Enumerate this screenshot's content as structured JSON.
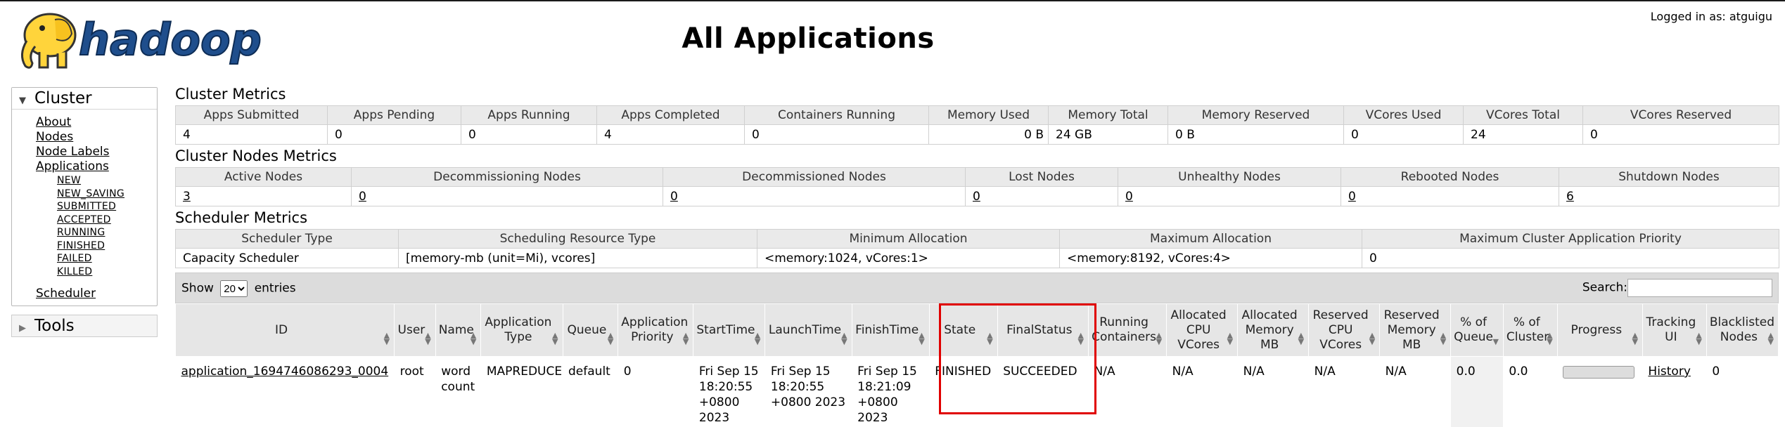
{
  "header": {
    "logo_text": "hadoop",
    "title": "All Applications",
    "logged_in": "Logged in as: atguigu"
  },
  "nav": {
    "cluster_label": "Cluster",
    "links": [
      "About",
      "Nodes",
      "Node Labels",
      "Applications"
    ],
    "app_states": [
      "NEW",
      "NEW_SAVING",
      "SUBMITTED",
      "ACCEPTED",
      "RUNNING",
      "FINISHED",
      "FAILED",
      "KILLED"
    ],
    "scheduler": "Scheduler",
    "tools_label": "Tools"
  },
  "cluster_metrics": {
    "title": "Cluster Metrics",
    "headers": [
      "Apps Submitted",
      "Apps Pending",
      "Apps Running",
      "Apps Completed",
      "Containers Running",
      "Memory Used",
      "Memory Total",
      "Memory Reserved",
      "VCores Used",
      "VCores Total",
      "VCores Reserved"
    ],
    "values": [
      "4",
      "0",
      "0",
      "4",
      "0",
      "0 B",
      "24 GB",
      "0 B",
      "0",
      "24",
      "0"
    ]
  },
  "node_metrics": {
    "title": "Cluster Nodes Metrics",
    "headers": [
      "Active Nodes",
      "Decommissioning Nodes",
      "Decommissioned Nodes",
      "Lost Nodes",
      "Unhealthy Nodes",
      "Rebooted Nodes",
      "Shutdown Nodes"
    ],
    "values": [
      "3",
      "0",
      "0",
      "0",
      "0",
      "0",
      "6"
    ]
  },
  "scheduler_metrics": {
    "title": "Scheduler Metrics",
    "headers": [
      "Scheduler Type",
      "Scheduling Resource Type",
      "Minimum Allocation",
      "Maximum Allocation",
      "Maximum Cluster Application Priority"
    ],
    "values": [
      "Capacity Scheduler",
      "[memory-mb (unit=Mi), vcores]",
      "<memory:1024, vCores:1>",
      "<memory:8192, vCores:4>",
      "0"
    ]
  },
  "apps_table": {
    "show_label": "Show",
    "show_value": "20",
    "entries_label": "entries",
    "search_label": "Search:",
    "search_value": "",
    "headers": [
      "ID",
      "User",
      "Name",
      "Application Type",
      "Queue",
      "Application Priority",
      "StartTime",
      "LaunchTime",
      "FinishTime",
      "State",
      "FinalStatus",
      "Running Containers",
      "Allocated CPU VCores",
      "Allocated Memory MB",
      "Reserved CPU VCores",
      "Reserved Memory MB",
      "% of Queue",
      "% of Cluster",
      "Progress",
      "Tracking UI",
      "Blacklisted Nodes"
    ],
    "row": {
      "id": "application_1694746086293_0004",
      "user": "root",
      "name": "word count",
      "type": "MAPREDUCE",
      "queue": "default",
      "priority": "0",
      "start": "Fri Sep 15 18:20:55 +0800 2023",
      "launch": "Fri Sep 15 18:20:55 +0800 2023",
      "finish": "Fri Sep 15 18:21:09 +0800 2023",
      "state": "FINISHED",
      "final_status": "SUCCEEDED",
      "running_containers": "N/A",
      "alloc_vcores": "N/A",
      "alloc_mem": "N/A",
      "res_vcores": "N/A",
      "res_mem": "N/A",
      "pct_queue": "0.0",
      "pct_cluster": "0.0",
      "progress": 0,
      "tracking": "History",
      "blacklisted": "0"
    }
  },
  "colors": {
    "highlight": "#e00000",
    "header_bg": "#e6e6e6",
    "logo_yellow": "#ffd43b",
    "logo_blue": "#1f4e8c"
  }
}
